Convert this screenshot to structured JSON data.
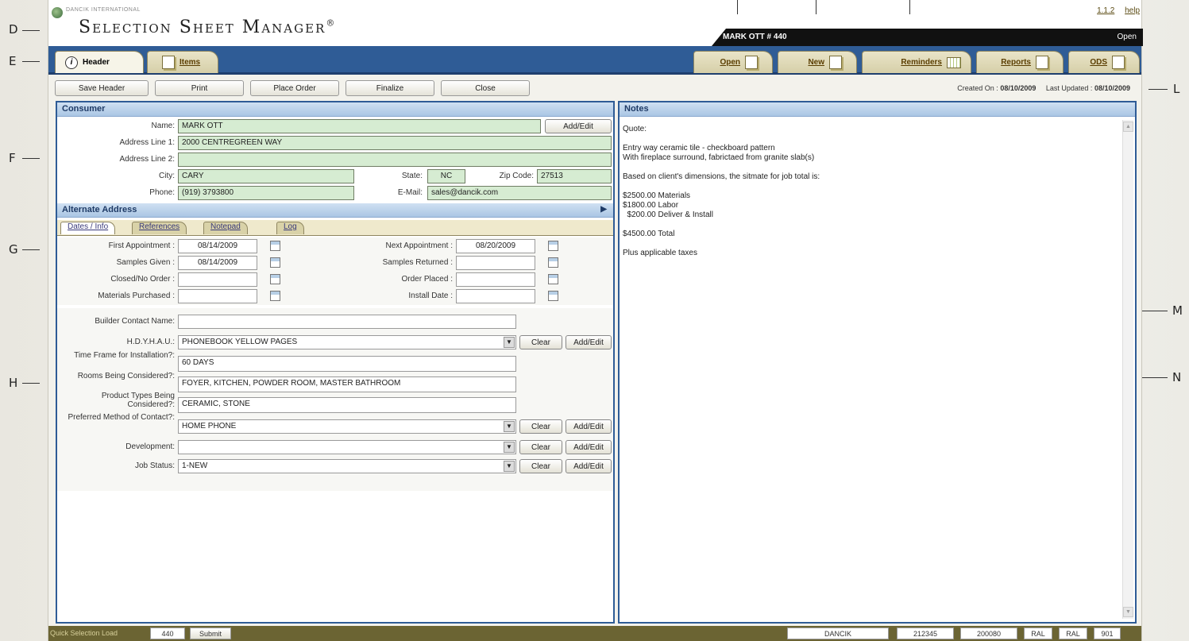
{
  "callouts": {
    "d": "D",
    "e": "E",
    "f": "F",
    "g": "G",
    "h": "H",
    "l": "L",
    "m": "M",
    "n": "N"
  },
  "brand": {
    "company": "DANCIK INTERNATIONAL",
    "title": "Selection Sheet Manager",
    "mark": "®"
  },
  "top_links": {
    "version": "1.1.2",
    "help": "help"
  },
  "userbar": {
    "user": "MARK OTT  # 440",
    "state": "Open"
  },
  "tabs": {
    "header": "Header",
    "items": "Items",
    "open": "Open",
    "new": "New",
    "reminders": "Reminders",
    "reports": "Reports",
    "ods": "ODS"
  },
  "actions": {
    "save_header": "Save Header",
    "print": "Print",
    "place_order": "Place Order",
    "finalize": "Finalize",
    "close": "Close"
  },
  "dates": {
    "created_label": "Created On :",
    "created": "08/10/2009",
    "updated_label": "Last Updated :",
    "updated": "08/10/2009"
  },
  "consumer": {
    "title": "Consumer",
    "name_label": "Name:",
    "name": "MARK OTT",
    "add_edit": "Add/Edit",
    "addr1_label": "Address Line 1:",
    "addr1": "2000 CENTREGREEN WAY",
    "addr2_label": "Address Line 2:",
    "addr2": "",
    "city_label": "City:",
    "city": "CARY",
    "state_label": "State:",
    "state": "NC",
    "zip_label": "Zip Code:",
    "zip": "27513",
    "phone_label": "Phone:",
    "phone": "(919) 3793800",
    "email_label": "E-Mail:",
    "email": "sales@dancik.com"
  },
  "alternate": {
    "title": "Alternate Address",
    "arrow": "▶"
  },
  "subtabs": {
    "dates": "Dates / Info",
    "references": "References",
    "notepad": "Notepad",
    "log": "Log"
  },
  "dates_info": {
    "first_appt_label": "First Appointment :",
    "first_appt": "08/14/2009",
    "next_appt_label": "Next Appointment :",
    "next_appt": "08/20/2009",
    "samples_given_label": "Samples Given :",
    "samples_given": "08/14/2009",
    "samples_returned_label": "Samples Returned :",
    "samples_returned": "",
    "closed_label": "Closed/No Order :",
    "closed": "",
    "order_placed_label": "Order Placed :",
    "order_placed": "",
    "materials_label": "Materials Purchased :",
    "materials": "",
    "install_label": "Install Date :",
    "install": ""
  },
  "info": {
    "builder_label": "Builder Contact Name:",
    "builder": "",
    "hdyhau_label": "H.D.Y.H.A.U.:",
    "hdyhau": "PHONEBOOK YELLOW PAGES",
    "timeframe_label": "Time Frame for Installation?:",
    "timeframe": "60 DAYS",
    "rooms_label": "Rooms Being Considered?:",
    "rooms": "FOYER, KITCHEN, POWDER ROOM, MASTER BATHROOM",
    "products_label": "Product Types Being Considered?:",
    "products": "CERAMIC, STONE",
    "contact_label": "Preferred Method of Contact?:",
    "contact": "HOME PHONE",
    "development_label": "Development:",
    "development": "",
    "status_label": "Job Status:",
    "status": "1-NEW",
    "clear": "Clear",
    "add_edit": "Add/Edit"
  },
  "notes": {
    "title": "Notes",
    "lines": [
      "Quote:",
      "",
      "Entry way ceramic tile - checkboard pattern",
      "With fireplace surround, fabrictaed from granite slab(s)",
      "",
      "Based on client's dimensions, the sitmate for job total is:",
      "",
      "$2500.00 Materials",
      "$1800.00 Labor",
      "  $200.00 Deliver & Install",
      "",
      "$4500.00 Total",
      "",
      "Plus applicable taxes"
    ]
  },
  "footer": {
    "quick_label": "Quick Selection Load",
    "quick_value": "440",
    "submit": "Submit",
    "boxes": [
      "DANCIK",
      "212345",
      "200080",
      "RAL",
      "RAL",
      "901"
    ]
  }
}
